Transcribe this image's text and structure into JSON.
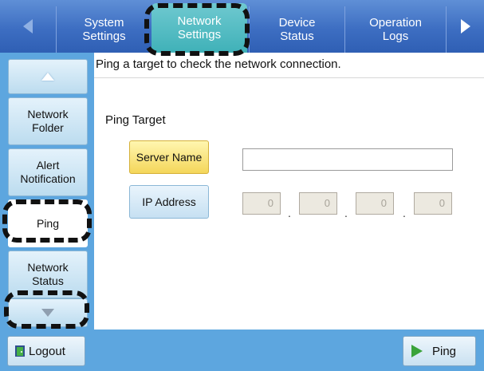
{
  "tabs": {
    "prev_icon": "left-arrow-icon",
    "next_icon": "right-arrow-icon",
    "items": [
      {
        "label": "System\nSettings"
      },
      {
        "label": "Network\nSettings"
      },
      {
        "label": "Device\nStatus"
      },
      {
        "label": "Operation\nLogs"
      }
    ],
    "selected": "Network\nSettings"
  },
  "sidebar": {
    "up_icon": "up-arrow-icon",
    "down_icon": "down-arrow-icon",
    "items": [
      {
        "label": "Network\nFolder"
      },
      {
        "label": "Alert\nNotification"
      },
      {
        "label": "Ping"
      },
      {
        "label": "Network\nStatus"
      }
    ],
    "selected": "Ping"
  },
  "main": {
    "description": "Ping a target to check the network connection.",
    "ping_target_label": "Ping Target",
    "server_name_button": "Server Name",
    "server_name_value": "",
    "ip_address_button": "IP Address",
    "ip_octets": [
      "0",
      "0",
      "0",
      "0"
    ],
    "ip_separator": "."
  },
  "footer": {
    "logout_label": "Logout",
    "ping_label": "Ping"
  },
  "colors": {
    "tab_bar": "#3d6ec2",
    "selected_tab": "#3fb1b8",
    "sidebar": "#5da6df",
    "server_button": "#f4d65a"
  }
}
